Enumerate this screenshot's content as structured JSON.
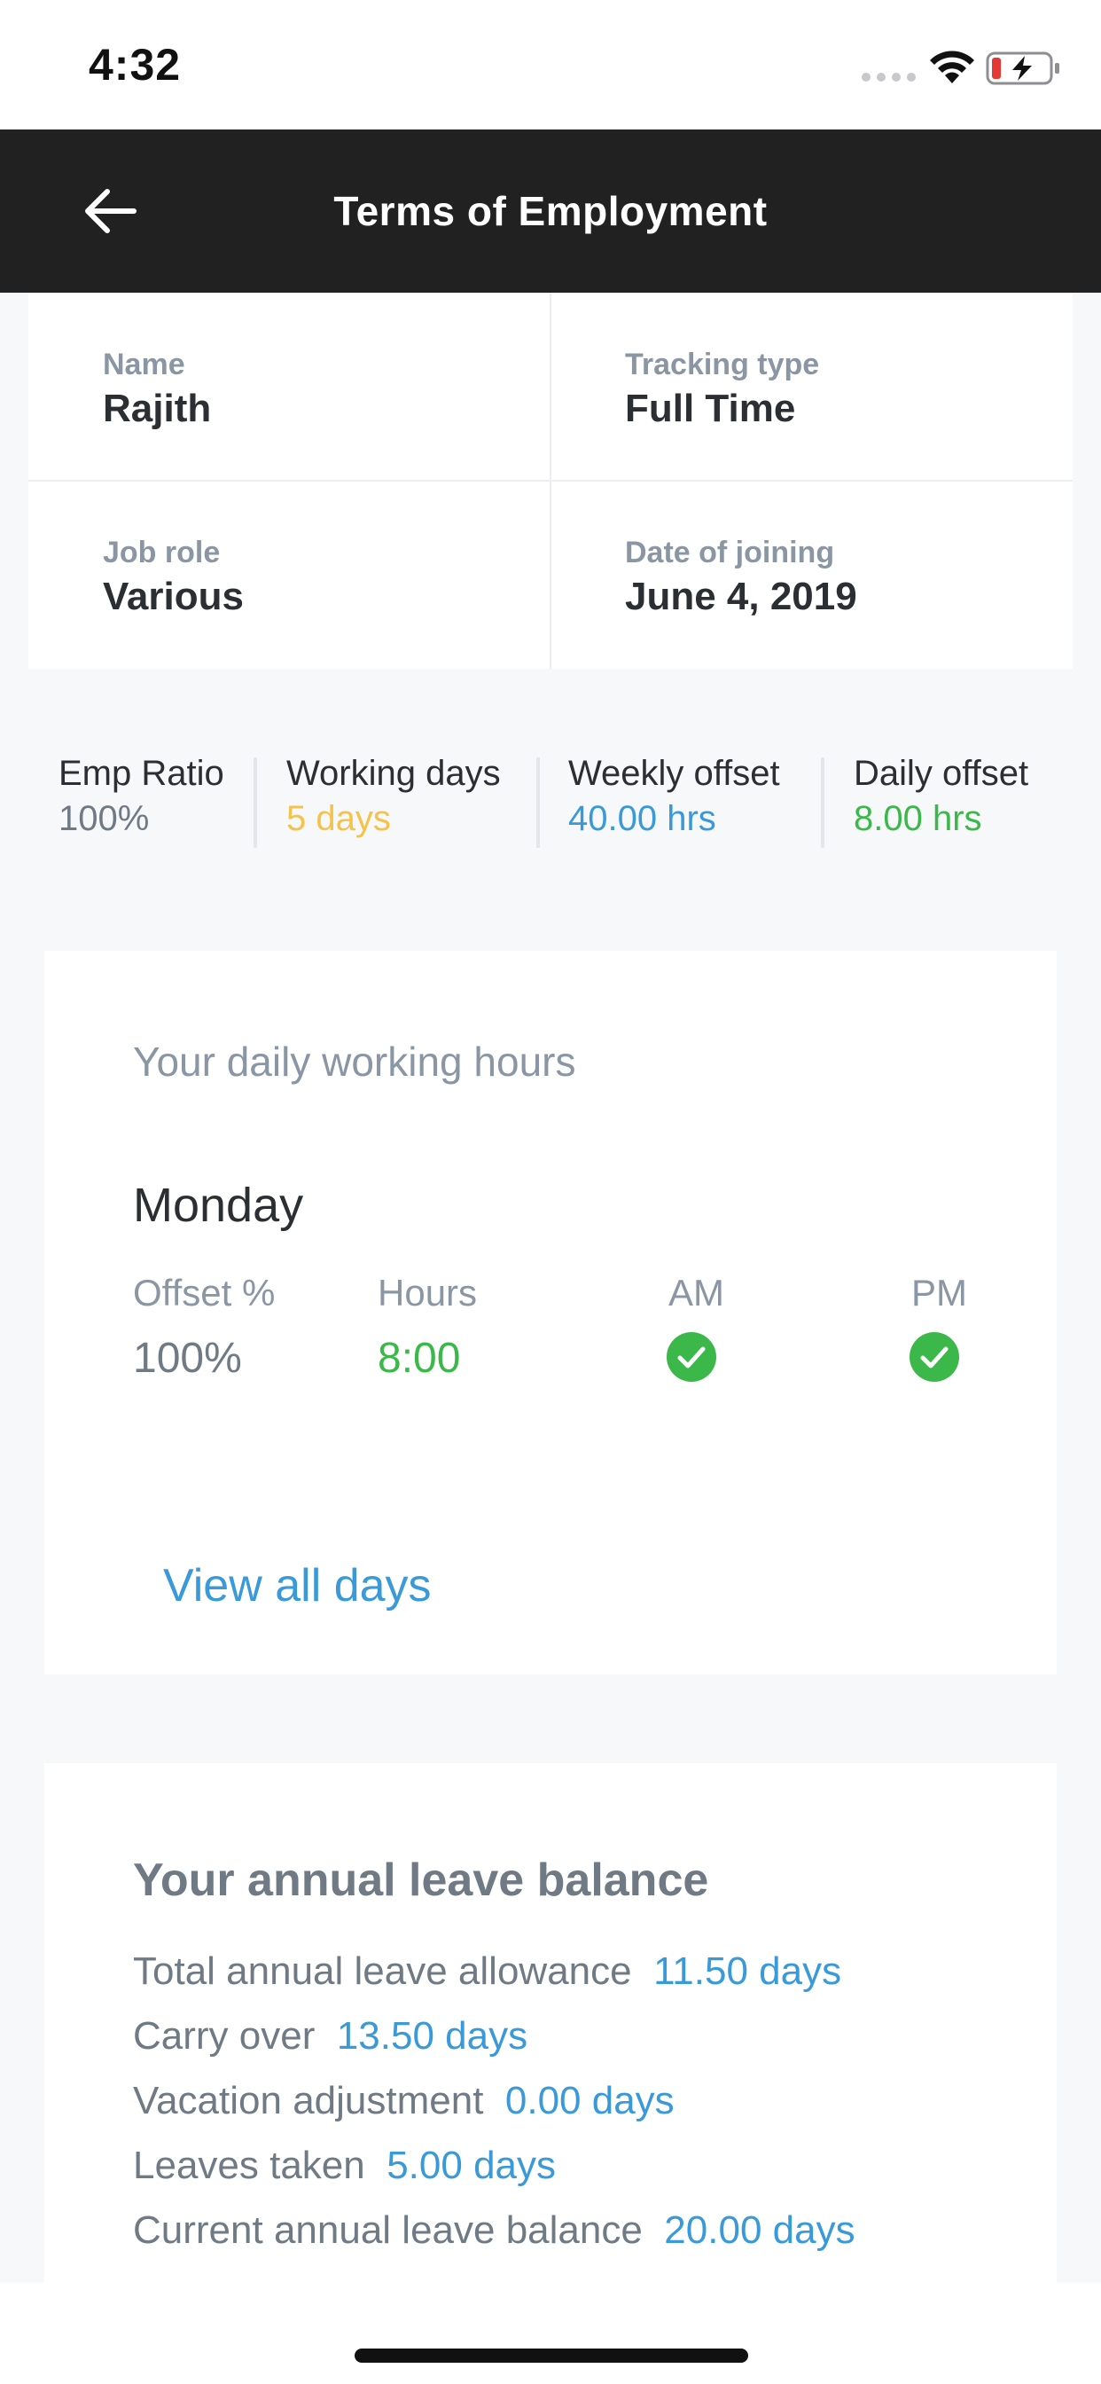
{
  "status_bar": {
    "time": "4:32"
  },
  "header": {
    "title": "Terms of Employment"
  },
  "info": {
    "name_label": "Name",
    "name_value": "Rajith",
    "tracking_label": "Tracking type",
    "tracking_value": "Full Time",
    "role_label": "Job role",
    "role_value": "Various",
    "joining_label": "Date of joining",
    "joining_value": "June 4, 2019"
  },
  "stats": [
    {
      "label": "Emp Ratio",
      "value": "100%",
      "color": "#6f7a85"
    },
    {
      "label": "Working days",
      "value": "5 days",
      "color": "#f5c24a"
    },
    {
      "label": "Weekly offset",
      "value": "40.00 hrs",
      "color": "#3a9ad9"
    },
    {
      "label": "Daily offset",
      "value": "8.00 hrs",
      "color": "#3cb84a"
    }
  ],
  "daily_hours": {
    "title": "Your daily working hours",
    "day": "Monday",
    "headers": {
      "offset": "Offset %",
      "hours": "Hours",
      "am": "AM",
      "pm": "PM"
    },
    "offset_value": "100%",
    "hours_value": "8:00",
    "am_checked": true,
    "pm_checked": true,
    "view_all": "View all days"
  },
  "leave": {
    "title": "Your annual leave balance",
    "rows": [
      {
        "label": "Total annual leave allowance",
        "value": "11.50 days"
      },
      {
        "label": "Carry over",
        "value": "13.50 days"
      },
      {
        "label": "Vacation adjustment",
        "value": "0.00 days"
      },
      {
        "label": "Leaves taken",
        "value": "5.00 days"
      },
      {
        "label": "Current annual leave balance",
        "value": "20.00 days"
      }
    ]
  },
  "colors": {
    "header_bg": "#212121",
    "accent_blue": "#3a9ad9",
    "check_green": "#3cb84a"
  }
}
